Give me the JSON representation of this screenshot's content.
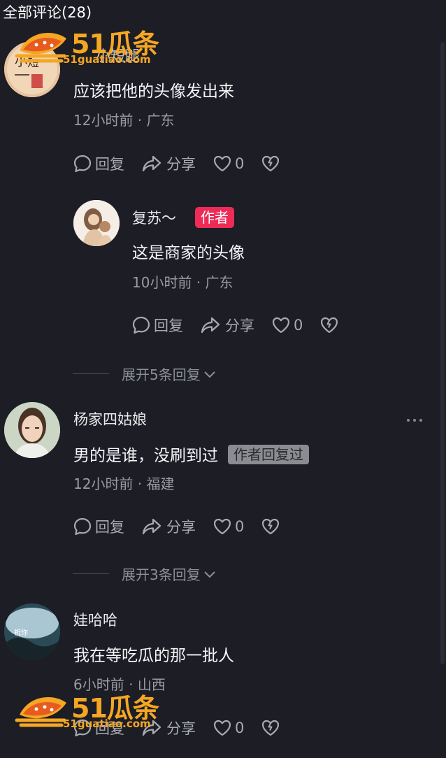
{
  "header": {
    "title": "全部评论(28)"
  },
  "watermark": {
    "brand": "51瓜条",
    "site": "51guatiao.com",
    "color": "#f5a623"
  },
  "colors": {
    "background": "#1c1d25",
    "author_badge": "#ee2b57",
    "secondary_text": "#9a9ca5"
  },
  "comments": [
    {
      "name": "小短腿",
      "text": "应该把他的头像发出来",
      "time": "12小时前",
      "location": "广东",
      "reply_label": "回复",
      "share_label": "分享",
      "likes": "0",
      "avatar_icon": "avatar-calligraphy",
      "replies": [
        {
          "name": "复苏～",
          "badge": "作者",
          "text": "这是商家的头像",
          "time": "10小时前",
          "location": "广东",
          "reply_label": "回复",
          "share_label": "分享",
          "likes": "0",
          "avatar_icon": "avatar-illustration"
        }
      ],
      "expand_label": "展开5条回复"
    },
    {
      "name": "杨家四姑娘",
      "text": "男的是谁，没刷到过",
      "badge": "作者回复过",
      "time": "12小时前",
      "location": "福建",
      "reply_label": "回复",
      "share_label": "分享",
      "likes": "0",
      "avatar_icon": "avatar-woman-photo",
      "expand_label": "展开3条回复"
    },
    {
      "name": "娃哈哈",
      "text": "我在等吃瓜的那一批人",
      "time": "6小时前",
      "location": "山西",
      "reply_label": "回复",
      "share_label": "分享",
      "likes": "0",
      "avatar_icon": "avatar-landscape"
    }
  ]
}
